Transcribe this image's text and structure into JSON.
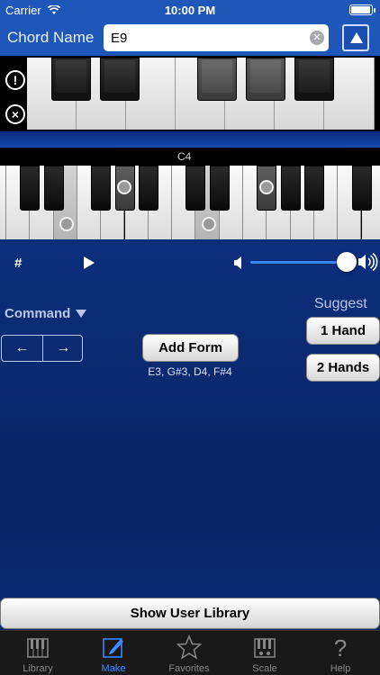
{
  "status_bar": {
    "carrier": "Carrier",
    "time": "10:00 PM"
  },
  "header": {
    "label": "Chord Name",
    "chord_value": "E9"
  },
  "keyboard": {
    "octave_label": "C4"
  },
  "controls": {
    "sharp_label": "#"
  },
  "command": {
    "label": "Command",
    "left_arrow": "←",
    "right_arrow": "→"
  },
  "add_form": {
    "label": "Add Form",
    "notes": "E3, G#3, D4, F#4"
  },
  "suggest": {
    "label": "Suggest",
    "one_hand": "1 Hand",
    "two_hands": "2 Hands"
  },
  "show_library": "Show User Library",
  "tabs": [
    {
      "label": "Library",
      "icon": "library-icon"
    },
    {
      "label": "Make",
      "icon": "pencil-icon",
      "active": true
    },
    {
      "label": "Favorites",
      "icon": "star-icon"
    },
    {
      "label": "Scale",
      "icon": "scale-icon"
    },
    {
      "label": "Help",
      "icon": "help-icon"
    }
  ],
  "colors": {
    "accent": "#3f8cff",
    "header": "#1e57b8",
    "background": "#0c2f7d"
  }
}
